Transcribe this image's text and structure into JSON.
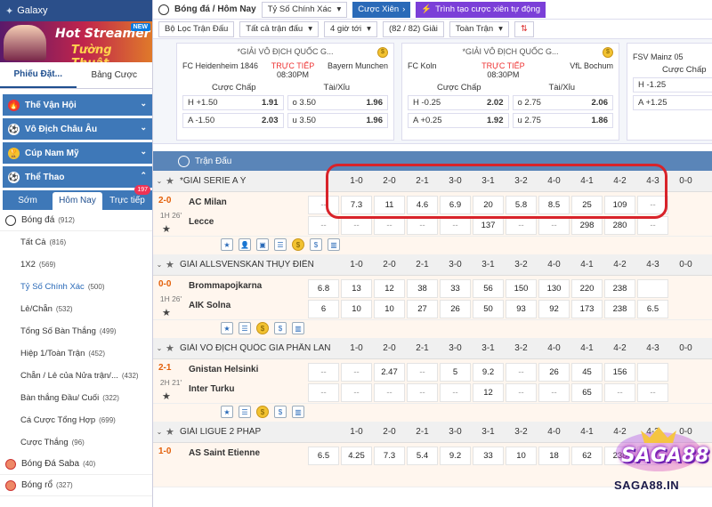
{
  "sidebar": {
    "brand": "Galaxy",
    "banner": {
      "line1": "Hot Streamer",
      "line2": "Tường Thuật",
      "badge": "NEW"
    },
    "slip_tabs": [
      "Phiếu Đặt...",
      "Bảng Cược"
    ],
    "categories": [
      "Thế Vận Hội",
      "Vô Địch Châu Âu",
      "Cúp Nam Mỹ",
      "Thể Thao"
    ],
    "sport_tabs": [
      "Sớm",
      "Hôm Nay",
      "Trực tiếp"
    ],
    "live_badge": "197",
    "sports": [
      {
        "label": "Bóng đá",
        "count": "(912)"
      },
      {
        "label": "Bóng Đá Saba",
        "count": "(40)"
      },
      {
        "label": "Bóng rổ",
        "count": "(327)"
      }
    ],
    "subs": [
      {
        "label": "Tất Cả",
        "count": "(816)"
      },
      {
        "label": "1X2",
        "count": "(569)"
      },
      {
        "label": "Tỷ Số Chính Xác",
        "count": "(500)"
      },
      {
        "label": "Lẻ/Chẵn",
        "count": "(532)"
      },
      {
        "label": "Tổng Số Bàn Thắng",
        "count": "(499)"
      },
      {
        "label": "Hiệp 1/Toàn Trận",
        "count": "(452)"
      },
      {
        "label": "Chẵn / Lẻ của Nửa trận/...",
        "count": "(432)"
      },
      {
        "label": "Bàn thắng Đầu/ Cuối",
        "count": "(322)"
      },
      {
        "label": "Cá Cược Tổng Hợp",
        "count": "(699)"
      },
      {
        "label": "Cược Thắng",
        "count": "(96)"
      }
    ]
  },
  "topbar": {
    "crumb": "Bóng đá / Hôm Nay",
    "select": "Tỷ Số Chính Xác",
    "btn_parlay": "Cược Xiên",
    "btn_create": "Trình tạo cược xiên tự động"
  },
  "filters": [
    "Bộ Lọc Trận Đấu",
    "Tất cả trận đấu",
    "4 giờ tới",
    "(82 / 82) Giải",
    "Toàn Trận"
  ],
  "cards": [
    {
      "league": "*GIẢI VÔ ĐỊCH QUỐC G...",
      "home": "FC Heidenheim 1846",
      "away": "Bayern Munchen",
      "live": "TRỰC TIẾP",
      "time": "08:30PM",
      "h1": "Cược Chấp",
      "h2": "Tài/Xỉu",
      "rows": [
        [
          "H +1.50",
          "1.91",
          "o 3.50",
          "1.96"
        ],
        [
          "A -1.50",
          "2.03",
          "u 3.50",
          "1.96"
        ]
      ]
    },
    {
      "league": "*GIẢI VÔ ĐỊCH QUỐC G...",
      "home": "FC Koln",
      "away": "VfL Bochum",
      "live": "TRỰC TIẾP",
      "time": "08:30PM",
      "h1": "Cược Chấp",
      "h2": "Tài/Xỉu",
      "rows": [
        [
          "H -0.25",
          "2.02",
          "o 2.75",
          "2.06"
        ],
        [
          "A +0.25",
          "1.92",
          "u 2.75",
          "1.86"
        ]
      ]
    },
    {
      "league": "",
      "home": "FSV Mainz 05",
      "away": "",
      "live": "",
      "time": "",
      "h1": "Cược Chấp",
      "h2": "",
      "rows": [
        [
          "H -1.25",
          "",
          "",
          ""
        ],
        [
          "A +1.25",
          "",
          "",
          ""
        ]
      ]
    }
  ],
  "section_title": "Trận Đấu",
  "score_headers": [
    "1-0",
    "2-0",
    "2-1",
    "3-0",
    "3-1",
    "3-2",
    "4-0",
    "4-1",
    "4-2",
    "4-3",
    "0-0"
  ],
  "leagues": [
    {
      "name": "*GIẢI SERIE A Ý",
      "score": "2-0",
      "time": "1H 26'",
      "home": "AC Milan",
      "away": "Lecce",
      "r1": [
        "--",
        "7.3",
        "11",
        "4.6",
        "6.9",
        "20",
        "5.8",
        "8.5",
        "25",
        "109",
        "--"
      ],
      "r2": [
        "--",
        "--",
        "--",
        "--",
        "--",
        "137",
        "--",
        "--",
        "298",
        "280",
        "--"
      ]
    },
    {
      "name": "GIẢI ALLSVENSKAN THỤY ĐIỂN",
      "score": "0-0",
      "time": "1H 26'",
      "home": "Brommapojkarna",
      "away": "AIK Solna",
      "r1": [
        "6.8",
        "13",
        "12",
        "38",
        "33",
        "56",
        "150",
        "130",
        "220",
        "238",
        ""
      ],
      "r2": [
        "6",
        "10",
        "10",
        "27",
        "26",
        "50",
        "93",
        "92",
        "173",
        "238",
        "6.5"
      ]
    },
    {
      "name": "GIẢI VÔ ĐỊCH QUỐC GIA PHẦN LAN",
      "score": "2-1",
      "time": "2H 21'",
      "home": "Gnistan Helsinki",
      "away": "Inter Turku",
      "r1": [
        "--",
        "--",
        "2.47",
        "--",
        "5",
        "9.2",
        "--",
        "26",
        "45",
        "156",
        ""
      ],
      "r2": [
        "--",
        "--",
        "--",
        "--",
        "--",
        "12",
        "--",
        "--",
        "65",
        "--",
        "--"
      ]
    },
    {
      "name": "GIẢI LIGUE 2 PHÁP",
      "score": "1-0",
      "time": "",
      "home": "AS Saint Etienne",
      "away": "",
      "r1": [
        "6.5",
        "4.25",
        "7.3",
        "5.4",
        "9.2",
        "33",
        "10",
        "18",
        "62",
        "238",
        ""
      ],
      "r2": []
    }
  ],
  "watermark": {
    "logo": "SAGA88",
    "url": "SAGA88.IN"
  },
  "colors": {
    "primary": "#3e78b8",
    "section": "#5a85b8",
    "highlight": "#d8232a",
    "score": "#e3600a",
    "purple": "#7b3fd8"
  }
}
